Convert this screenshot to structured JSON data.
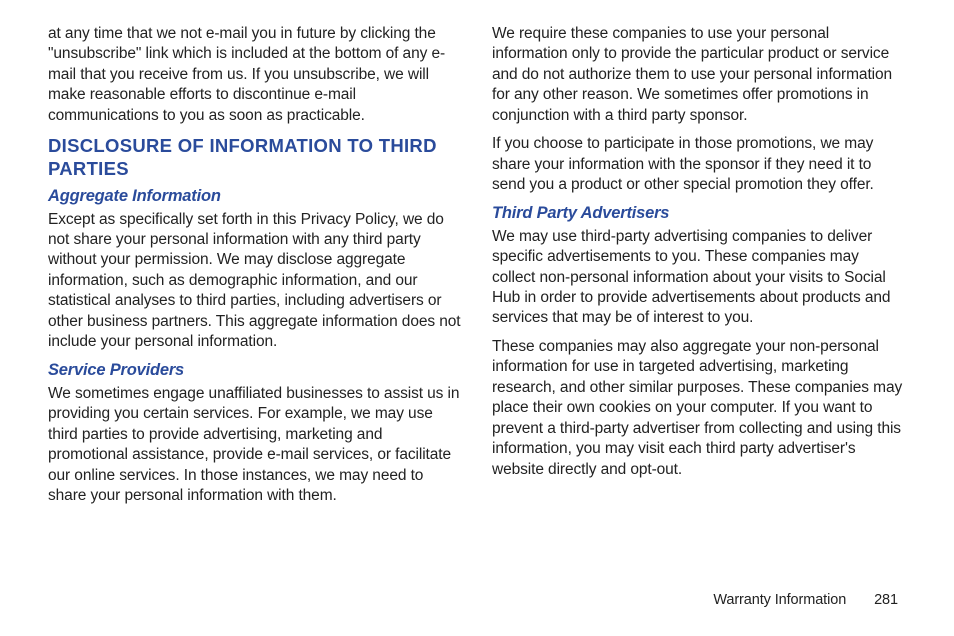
{
  "leftColumn": {
    "para1": "at any time that we not e-mail you in future by clicking the \"unsubscribe\" link which is included at the bottom of any e-mail that you receive from us. If you unsubscribe, we will make reasonable efforts to discontinue e-mail communications to you as soon as practicable.",
    "heading1": "DISCLOSURE OF INFORMATION TO THIRD PARTIES",
    "sub1": "Aggregate Information",
    "para2": "Except as specifically set forth in this Privacy Policy, we do not share your personal information with any third party without your permission. We may disclose aggregate information, such as demographic information, and our statistical analyses to third parties, including advertisers or other business partners. This aggregate information does not include your personal information.",
    "sub2": "Service Providers",
    "para3": "We sometimes engage unaffiliated businesses to assist us in providing you certain services. For example, we may use third parties to provide advertising, marketing and promotional assistance, provide e-mail services, or facilitate our online services. In those instances, we may need to share your personal information with them."
  },
  "rightColumn": {
    "para1": "We require these companies to use your personal information only to provide the particular product or service and do not authorize them to use your personal information for any other reason. We sometimes offer promotions in conjunction with a third party sponsor.",
    "para2": "If you choose to participate in those promotions, we may share your information with the sponsor if they need it to send you a product or other special promotion they offer.",
    "sub1": "Third Party Advertisers",
    "para3": "We may use third-party advertising companies to deliver specific advertisements to you. These companies may collect non-personal information about your visits to Social Hub in order to provide advertisements about products and services that may be of interest to you.",
    "para4": "These companies may also aggregate your non-personal information for use in targeted advertising, marketing research, and other similar purposes. These companies may place their own cookies on your computer. If you want to prevent a third-party advertiser from collecting and using this information, you may visit each third party advertiser's website directly and opt-out."
  },
  "footer": {
    "section": "Warranty Information",
    "page": "281"
  }
}
